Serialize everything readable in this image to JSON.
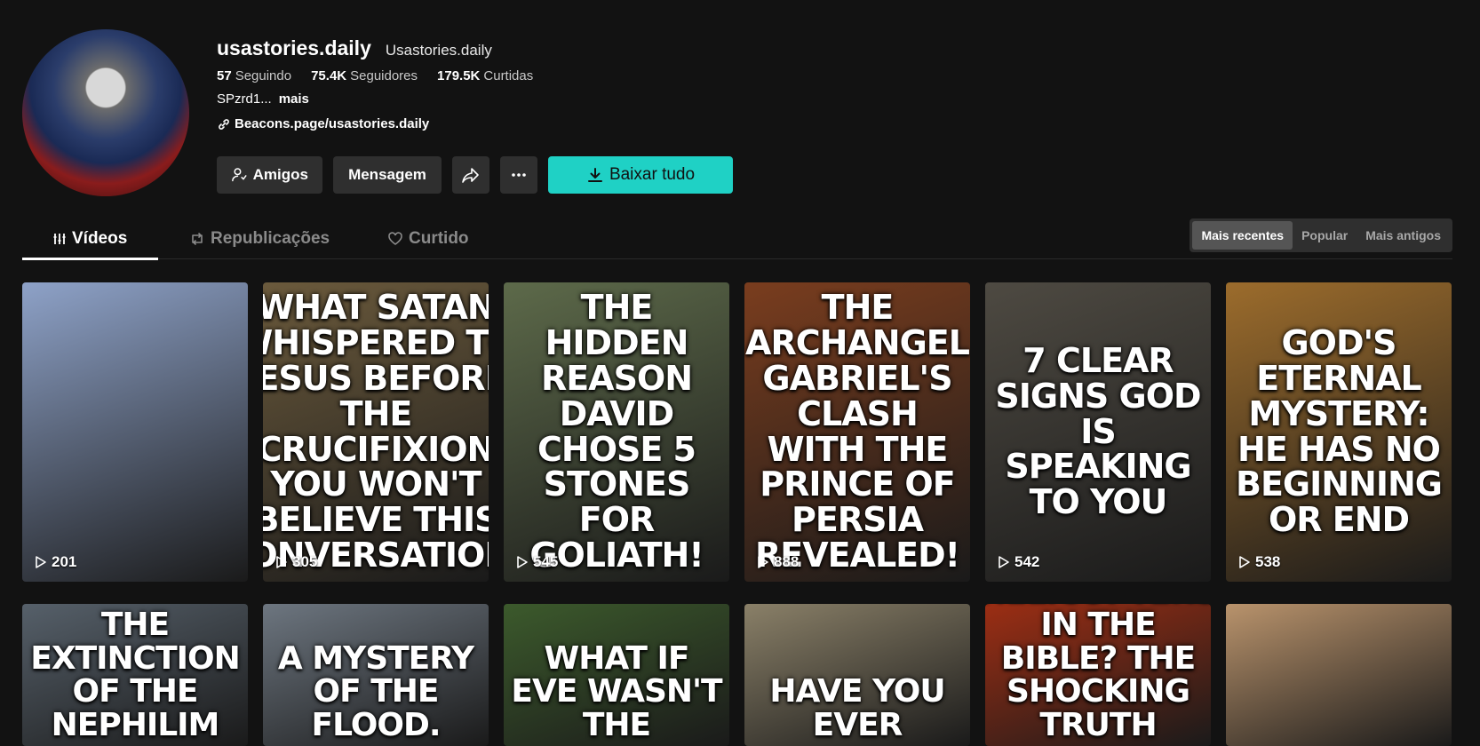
{
  "profile": {
    "username": "usastories.daily",
    "nickname": "Usastories.daily",
    "stats": [
      {
        "value": "57",
        "label": "Seguindo"
      },
      {
        "value": "75.4K",
        "label": "Seguidores"
      },
      {
        "value": "179.5K",
        "label": "Curtidas"
      }
    ],
    "bio": "SPzrd1...",
    "bio_more": "mais",
    "link": "Beacons.page/usastories.daily"
  },
  "buttons": {
    "friends": "Amigos",
    "message": "Mensagem",
    "download_all": "Baixar tudo"
  },
  "tabs": [
    {
      "label": "Vídeos",
      "icon": "grid-icon"
    },
    {
      "label": "Republicações",
      "icon": "repost-icon"
    },
    {
      "label": "Curtido",
      "icon": "heart-icon"
    }
  ],
  "sort": [
    "Mais recentes",
    "Popular",
    "Mais antigos"
  ],
  "videos_row1": [
    {
      "title": "",
      "views": "201",
      "bg": "#8ea2c8"
    },
    {
      "title": "WHAT SATAN WHISPERED TO JESUS BEFORE THE CRUCIFIXION YOU WON'T BELIEVE THIS CONVERSATION!",
      "views": "305",
      "bg": "#6b5a3c"
    },
    {
      "title": "THE HIDDEN REASON DAVID CHOSE 5 STONES FOR GOLIATH!",
      "views": "545",
      "bg": "#5d6a4a"
    },
    {
      "title": "THE ARCHANGEL GABRIEL'S CLASH WITH THE PRINCE OF PERSIA REVEALED!",
      "views": "888",
      "bg": "#7a3d1e"
    },
    {
      "title": "7 CLEAR SIGNS GOD IS SPEAKING TO YOU",
      "views": "542",
      "bg": "#4e4a42"
    },
    {
      "title": "GOD'S ETERNAL MYSTERY: HE HAS NO BEGINNING OR END",
      "views": "538",
      "bg": "#9c6c2c"
    }
  ],
  "videos_row2": [
    {
      "title": "THE EXTINCTION OF THE NEPHILIM",
      "bg": "#56606a"
    },
    {
      "title": "A MYSTERY OF THE FLOOD.",
      "bg": "#6d7680"
    },
    {
      "title": "What if Eve wasn't the",
      "bg": "#3c5a2c"
    },
    {
      "title": "Have You Ever",
      "bg": "#8a8068"
    },
    {
      "title": "HELICOPTERS IN THE BIBLE? THE SHOCKING TRUTH",
      "bg": "#9c2e14"
    },
    {
      "title": "",
      "bg": "#b9936c"
    }
  ]
}
